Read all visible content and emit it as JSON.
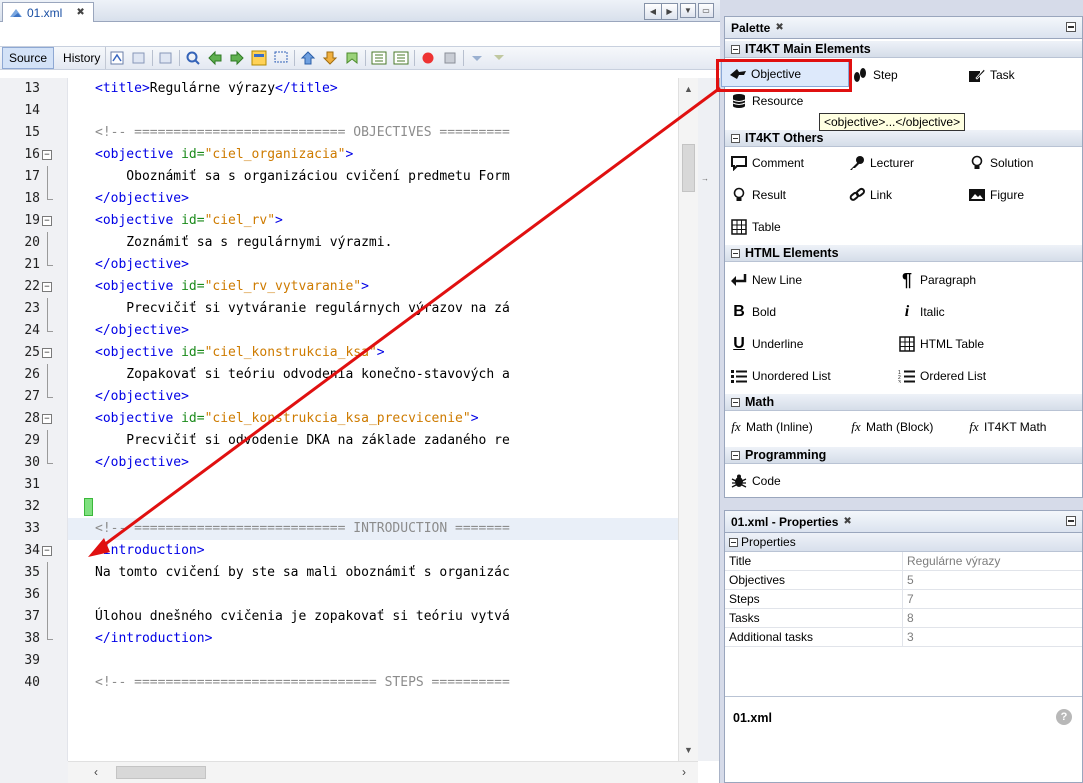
{
  "editor": {
    "file_tab": "01.xml",
    "toolbar": {
      "source_label": "Source",
      "history_label": "History"
    },
    "lines": [
      {
        "n": "13",
        "fold": "",
        "parts": [
          [
            "tag",
            "<title>"
          ],
          [
            "txt",
            "Regulárne výrazy"
          ],
          [
            "tag",
            "</title>"
          ]
        ]
      },
      {
        "n": "14",
        "fold": "",
        "parts": []
      },
      {
        "n": "15",
        "fold": "",
        "parts": [
          [
            "cmt",
            "<!-- =========================== OBJECTIVES ========="
          ]
        ]
      },
      {
        "n": "16",
        "fold": "open",
        "parts": [
          [
            "tag",
            "<objective "
          ],
          [
            "attr",
            "id="
          ],
          [
            "val",
            "\"ciel_organizacia\""
          ],
          [
            "tag",
            ">"
          ]
        ]
      },
      {
        "n": "17",
        "fold": "mid",
        "parts": [
          [
            "txt",
            "    Oboznámiť sa s organizáciou cvičení predmetu Form"
          ]
        ]
      },
      {
        "n": "18",
        "fold": "end",
        "parts": [
          [
            "tag",
            "</objective>"
          ]
        ]
      },
      {
        "n": "19",
        "fold": "open",
        "parts": [
          [
            "tag",
            "<objective "
          ],
          [
            "attr",
            "id="
          ],
          [
            "val",
            "\"ciel_rv\""
          ],
          [
            "tag",
            ">"
          ]
        ]
      },
      {
        "n": "20",
        "fold": "mid",
        "parts": [
          [
            "txt",
            "    Zoznámiť sa s regulárnymi výrazmi."
          ]
        ]
      },
      {
        "n": "21",
        "fold": "end",
        "parts": [
          [
            "tag",
            "</objective>"
          ]
        ]
      },
      {
        "n": "22",
        "fold": "open",
        "parts": [
          [
            "tag",
            "<objective "
          ],
          [
            "attr",
            "id="
          ],
          [
            "val",
            "\"ciel_rv_vytvaranie\""
          ],
          [
            "tag",
            ">"
          ]
        ]
      },
      {
        "n": "23",
        "fold": "mid",
        "parts": [
          [
            "txt",
            "    Precvičiť si vytváranie regulárnych výrazov na zá"
          ]
        ]
      },
      {
        "n": "24",
        "fold": "end",
        "parts": [
          [
            "tag",
            "</objective>"
          ]
        ]
      },
      {
        "n": "25",
        "fold": "open",
        "parts": [
          [
            "tag",
            "<objective "
          ],
          [
            "attr",
            "id="
          ],
          [
            "val",
            "\"ciel_konstrukcia_ksa\""
          ],
          [
            "tag",
            ">"
          ]
        ]
      },
      {
        "n": "26",
        "fold": "mid",
        "parts": [
          [
            "txt",
            "    Zopakovať si teóriu odvodenia konečno-stavových a"
          ]
        ]
      },
      {
        "n": "27",
        "fold": "end",
        "parts": [
          [
            "tag",
            "</objective>"
          ]
        ]
      },
      {
        "n": "28",
        "fold": "open",
        "parts": [
          [
            "tag",
            "<objective "
          ],
          [
            "attr",
            "id="
          ],
          [
            "val",
            "\"ciel_konstrukcia_ksa_precvicenie\""
          ],
          [
            "tag",
            ">"
          ]
        ]
      },
      {
        "n": "29",
        "fold": "mid",
        "parts": [
          [
            "txt",
            "    Precvičiť si odvodenie DKA na základe zadaného re"
          ]
        ]
      },
      {
        "n": "30",
        "fold": "end",
        "parts": [
          [
            "tag",
            "</objective>"
          ]
        ]
      },
      {
        "n": "31",
        "fold": "",
        "parts": []
      },
      {
        "n": "32",
        "fold": "",
        "parts": []
      },
      {
        "n": "33",
        "fold": "",
        "parts": [
          [
            "cmt",
            "<!-- =========================== INTRODUCTION ======="
          ]
        ]
      },
      {
        "n": "34",
        "fold": "open",
        "parts": [
          [
            "tag",
            "<introduction>"
          ]
        ]
      },
      {
        "n": "35",
        "fold": "mid",
        "parts": [
          [
            "txt",
            "Na tomto cvičení by ste sa mali oboznámiť s organizác"
          ]
        ]
      },
      {
        "n": "36",
        "fold": "mid",
        "parts": []
      },
      {
        "n": "37",
        "fold": "mid",
        "parts": [
          [
            "txt",
            "Úlohou dnešného cvičenia je zopakovať si teóriu vytvá"
          ]
        ]
      },
      {
        "n": "38",
        "fold": "end",
        "parts": [
          [
            "tag",
            "</introduction>"
          ]
        ]
      },
      {
        "n": "39",
        "fold": "",
        "parts": []
      },
      {
        "n": "40",
        "fold": "",
        "parts": [
          [
            "cmt",
            "<!-- =============================== STEPS =========="
          ]
        ]
      }
    ]
  },
  "palette": {
    "title": "Palette",
    "categories": [
      {
        "name": "IT4KT Main Elements"
      },
      {
        "name": "IT4KT Others"
      },
      {
        "name": "HTML Elements"
      },
      {
        "name": "Math"
      },
      {
        "name": "Programming"
      }
    ],
    "items": {
      "objective": "Objective",
      "step": "Step",
      "task": "Task",
      "resources": "Resource",
      "comment": "Comment",
      "lecturer": "Lecturer",
      "solution": "Solution",
      "result": "Result",
      "link": "Link",
      "figure": "Figure",
      "table": "Table",
      "new_line": "New Line",
      "paragraph": "Paragraph",
      "bold": "Bold",
      "italic": "Italic",
      "underline": "Underline",
      "html_table": "HTML Table",
      "unordered_list": "Unordered List",
      "ordered_list": "Ordered List",
      "math_inline": "Math (Inline)",
      "math_block": "Math (Block)",
      "it4kt_math": "IT4KT Math",
      "code": "Code"
    },
    "tooltip": "<objective>...</objective>"
  },
  "properties": {
    "title": "01.xml - Properties",
    "section": "Properties",
    "rows": [
      {
        "key": "Title",
        "value": "Regulárne výrazy"
      },
      {
        "key": "Objectives",
        "value": "5"
      },
      {
        "key": "Steps",
        "value": "7"
      },
      {
        "key": "Tasks",
        "value": "8"
      },
      {
        "key": "Additional tasks",
        "value": "3"
      }
    ],
    "description_title": "01.xml"
  },
  "colors": {
    "tag": "#0000e6",
    "attribute": "#1a8a1a",
    "value": "#ce7b00",
    "comment": "#8c8c8c",
    "annotation_red": "#e01010"
  }
}
